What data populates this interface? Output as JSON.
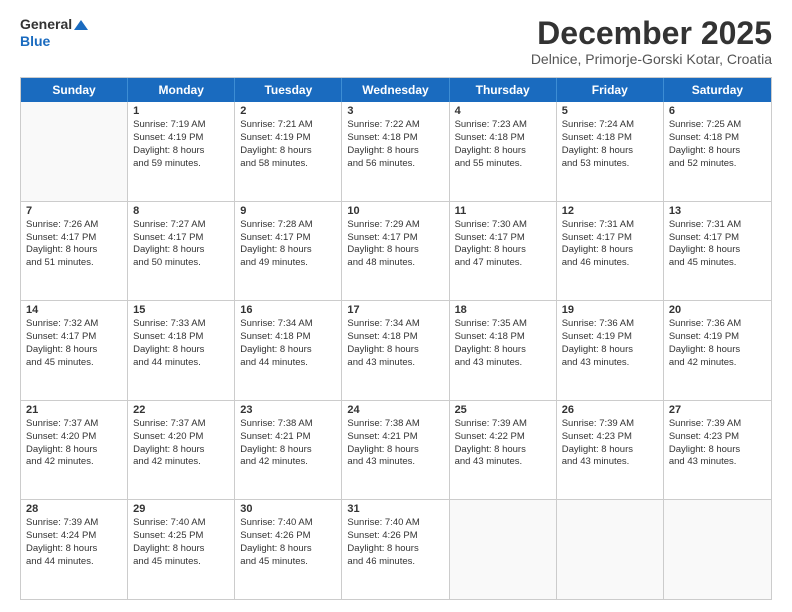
{
  "header": {
    "logo_line1": "General",
    "logo_line2": "Blue",
    "month_title": "December 2025",
    "subtitle": "Delnice, Primorje-Gorski Kotar, Croatia"
  },
  "weekdays": [
    "Sunday",
    "Monday",
    "Tuesday",
    "Wednesday",
    "Thursday",
    "Friday",
    "Saturday"
  ],
  "rows": [
    [
      {
        "day": "",
        "lines": []
      },
      {
        "day": "1",
        "lines": [
          "Sunrise: 7:19 AM",
          "Sunset: 4:19 PM",
          "Daylight: 8 hours",
          "and 59 minutes."
        ]
      },
      {
        "day": "2",
        "lines": [
          "Sunrise: 7:21 AM",
          "Sunset: 4:19 PM",
          "Daylight: 8 hours",
          "and 58 minutes."
        ]
      },
      {
        "day": "3",
        "lines": [
          "Sunrise: 7:22 AM",
          "Sunset: 4:18 PM",
          "Daylight: 8 hours",
          "and 56 minutes."
        ]
      },
      {
        "day": "4",
        "lines": [
          "Sunrise: 7:23 AM",
          "Sunset: 4:18 PM",
          "Daylight: 8 hours",
          "and 55 minutes."
        ]
      },
      {
        "day": "5",
        "lines": [
          "Sunrise: 7:24 AM",
          "Sunset: 4:18 PM",
          "Daylight: 8 hours",
          "and 53 minutes."
        ]
      },
      {
        "day": "6",
        "lines": [
          "Sunrise: 7:25 AM",
          "Sunset: 4:18 PM",
          "Daylight: 8 hours",
          "and 52 minutes."
        ]
      }
    ],
    [
      {
        "day": "7",
        "lines": [
          "Sunrise: 7:26 AM",
          "Sunset: 4:17 PM",
          "Daylight: 8 hours",
          "and 51 minutes."
        ]
      },
      {
        "day": "8",
        "lines": [
          "Sunrise: 7:27 AM",
          "Sunset: 4:17 PM",
          "Daylight: 8 hours",
          "and 50 minutes."
        ]
      },
      {
        "day": "9",
        "lines": [
          "Sunrise: 7:28 AM",
          "Sunset: 4:17 PM",
          "Daylight: 8 hours",
          "and 49 minutes."
        ]
      },
      {
        "day": "10",
        "lines": [
          "Sunrise: 7:29 AM",
          "Sunset: 4:17 PM",
          "Daylight: 8 hours",
          "and 48 minutes."
        ]
      },
      {
        "day": "11",
        "lines": [
          "Sunrise: 7:30 AM",
          "Sunset: 4:17 PM",
          "Daylight: 8 hours",
          "and 47 minutes."
        ]
      },
      {
        "day": "12",
        "lines": [
          "Sunrise: 7:31 AM",
          "Sunset: 4:17 PM",
          "Daylight: 8 hours",
          "and 46 minutes."
        ]
      },
      {
        "day": "13",
        "lines": [
          "Sunrise: 7:31 AM",
          "Sunset: 4:17 PM",
          "Daylight: 8 hours",
          "and 45 minutes."
        ]
      }
    ],
    [
      {
        "day": "14",
        "lines": [
          "Sunrise: 7:32 AM",
          "Sunset: 4:17 PM",
          "Daylight: 8 hours",
          "and 45 minutes."
        ]
      },
      {
        "day": "15",
        "lines": [
          "Sunrise: 7:33 AM",
          "Sunset: 4:18 PM",
          "Daylight: 8 hours",
          "and 44 minutes."
        ]
      },
      {
        "day": "16",
        "lines": [
          "Sunrise: 7:34 AM",
          "Sunset: 4:18 PM",
          "Daylight: 8 hours",
          "and 44 minutes."
        ]
      },
      {
        "day": "17",
        "lines": [
          "Sunrise: 7:34 AM",
          "Sunset: 4:18 PM",
          "Daylight: 8 hours",
          "and 43 minutes."
        ]
      },
      {
        "day": "18",
        "lines": [
          "Sunrise: 7:35 AM",
          "Sunset: 4:18 PM",
          "Daylight: 8 hours",
          "and 43 minutes."
        ]
      },
      {
        "day": "19",
        "lines": [
          "Sunrise: 7:36 AM",
          "Sunset: 4:19 PM",
          "Daylight: 8 hours",
          "and 43 minutes."
        ]
      },
      {
        "day": "20",
        "lines": [
          "Sunrise: 7:36 AM",
          "Sunset: 4:19 PM",
          "Daylight: 8 hours",
          "and 42 minutes."
        ]
      }
    ],
    [
      {
        "day": "21",
        "lines": [
          "Sunrise: 7:37 AM",
          "Sunset: 4:20 PM",
          "Daylight: 8 hours",
          "and 42 minutes."
        ]
      },
      {
        "day": "22",
        "lines": [
          "Sunrise: 7:37 AM",
          "Sunset: 4:20 PM",
          "Daylight: 8 hours",
          "and 42 minutes."
        ]
      },
      {
        "day": "23",
        "lines": [
          "Sunrise: 7:38 AM",
          "Sunset: 4:21 PM",
          "Daylight: 8 hours",
          "and 42 minutes."
        ]
      },
      {
        "day": "24",
        "lines": [
          "Sunrise: 7:38 AM",
          "Sunset: 4:21 PM",
          "Daylight: 8 hours",
          "and 43 minutes."
        ]
      },
      {
        "day": "25",
        "lines": [
          "Sunrise: 7:39 AM",
          "Sunset: 4:22 PM",
          "Daylight: 8 hours",
          "and 43 minutes."
        ]
      },
      {
        "day": "26",
        "lines": [
          "Sunrise: 7:39 AM",
          "Sunset: 4:23 PM",
          "Daylight: 8 hours",
          "and 43 minutes."
        ]
      },
      {
        "day": "27",
        "lines": [
          "Sunrise: 7:39 AM",
          "Sunset: 4:23 PM",
          "Daylight: 8 hours",
          "and 43 minutes."
        ]
      }
    ],
    [
      {
        "day": "28",
        "lines": [
          "Sunrise: 7:39 AM",
          "Sunset: 4:24 PM",
          "Daylight: 8 hours",
          "and 44 minutes."
        ]
      },
      {
        "day": "29",
        "lines": [
          "Sunrise: 7:40 AM",
          "Sunset: 4:25 PM",
          "Daylight: 8 hours",
          "and 45 minutes."
        ]
      },
      {
        "day": "30",
        "lines": [
          "Sunrise: 7:40 AM",
          "Sunset: 4:26 PM",
          "Daylight: 8 hours",
          "and 45 minutes."
        ]
      },
      {
        "day": "31",
        "lines": [
          "Sunrise: 7:40 AM",
          "Sunset: 4:26 PM",
          "Daylight: 8 hours",
          "and 46 minutes."
        ]
      },
      {
        "day": "",
        "lines": []
      },
      {
        "day": "",
        "lines": []
      },
      {
        "day": "",
        "lines": []
      }
    ]
  ]
}
